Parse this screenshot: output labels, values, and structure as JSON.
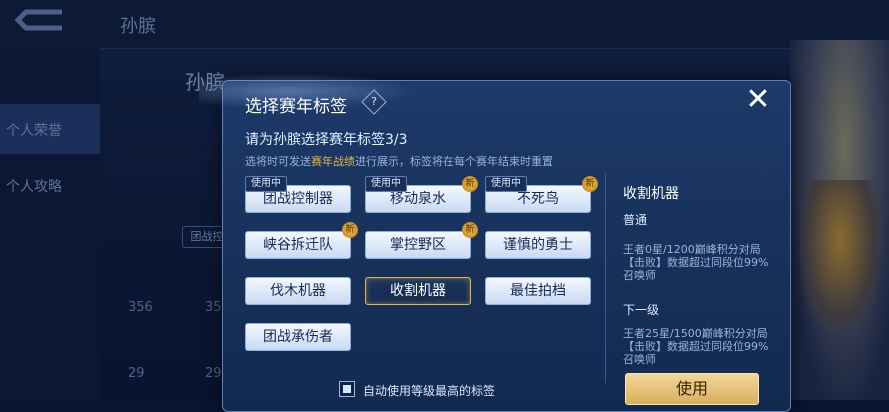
{
  "background": {
    "page_title": "孙膑",
    "hero_name": "孙膑",
    "sidebar_items": [
      "个人荣誉",
      "个人攻略"
    ],
    "stats": [
      "356",
      "29",
      "35",
      "29"
    ],
    "chip_label": "团战控"
  },
  "modal": {
    "title": "选择赛年标签",
    "help_symbol": "?",
    "close_symbol": "✕",
    "subtitle": "请为孙膑选择赛年标签3/3",
    "description_pre": "选将时可发送",
    "description_highlight": "赛年战绩",
    "description_post": "进行展示，标签将在每个赛年结束时重置",
    "in_use_label": "使用中",
    "new_label": "新",
    "tags": [
      {
        "label": "团战控制器",
        "in_use": true,
        "is_new": false,
        "selected": false
      },
      {
        "label": "移动泉水",
        "in_use": true,
        "is_new": true,
        "selected": false
      },
      {
        "label": "不死鸟",
        "in_use": true,
        "is_new": true,
        "selected": false
      },
      {
        "label": "峡谷拆迁队",
        "in_use": false,
        "is_new": true,
        "selected": false
      },
      {
        "label": "掌控野区",
        "in_use": false,
        "is_new": true,
        "selected": false
      },
      {
        "label": "谨慎的勇士",
        "in_use": false,
        "is_new": false,
        "selected": false
      },
      {
        "label": "伐木机器",
        "in_use": false,
        "is_new": false,
        "selected": false
      },
      {
        "label": "收割机器",
        "in_use": false,
        "is_new": false,
        "selected": true
      },
      {
        "label": "最佳拍档",
        "in_use": false,
        "is_new": false,
        "selected": false
      },
      {
        "label": "团战承伤者",
        "in_use": false,
        "is_new": false,
        "selected": false
      }
    ],
    "detail": {
      "name": "收割机器",
      "level_label": "普通",
      "level_desc": "王者0星/1200巅峰积分对局【击败】数据超过同段位99%召唤师",
      "next_label": "下一级",
      "next_desc": "王者25星/1500巅峰积分对局【击败】数据超过同段位99%召唤师",
      "use_button": "使用"
    },
    "auto_use_label": "自动使用等级最高的标签",
    "auto_use_checked": true
  },
  "colors": {
    "accent_gold": "#e3b550",
    "highlight_text": "#e6b54a",
    "modal_bg": "#1d3a6a"
  }
}
